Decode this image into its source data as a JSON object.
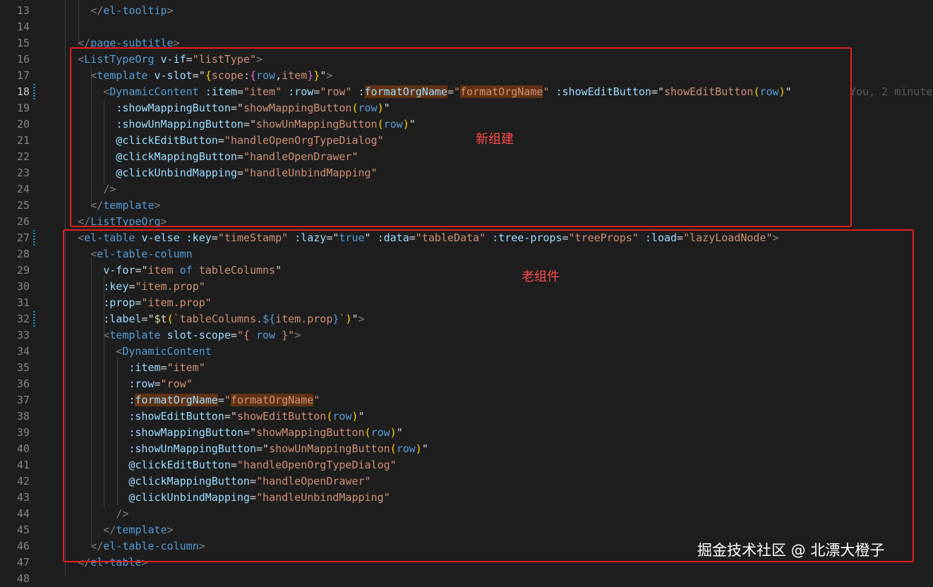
{
  "editor": {
    "lines": [
      {
        "n": "13",
        "indent": 6,
        "tokens": [
          [
            "</",
            "p"
          ],
          [
            "el-tooltip",
            "t"
          ],
          [
            ">",
            "p"
          ]
        ]
      },
      {
        "n": "14",
        "indent": 0,
        "tokens": []
      },
      {
        "n": "15",
        "indent": 4,
        "tokens": [
          [
            "</",
            "p"
          ],
          [
            "page-subtitle",
            "t"
          ],
          [
            ">",
            "p"
          ]
        ]
      },
      {
        "n": "16",
        "indent": 4,
        "tokens": [
          [
            "<",
            "p"
          ],
          [
            "ListTypeOrg",
            "t"
          ],
          [
            " ",
            "x"
          ],
          [
            "v-if",
            "a"
          ],
          [
            "=",
            "x"
          ],
          [
            "\"listType\"",
            "v"
          ],
          [
            ">",
            "p"
          ]
        ]
      },
      {
        "n": "17",
        "indent": 6,
        "tokens": [
          [
            "<",
            "p"
          ],
          [
            "template",
            "t"
          ],
          [
            " ",
            "x"
          ],
          [
            "v-slot",
            "a"
          ],
          [
            "=",
            "x"
          ],
          [
            "\"",
            "x"
          ],
          [
            "{",
            "y"
          ],
          [
            "scope",
            "v"
          ],
          [
            ":",
            "x"
          ],
          [
            "{",
            "m"
          ],
          [
            "row",
            "b"
          ],
          [
            ",",
            "x"
          ],
          [
            "item",
            "v"
          ],
          [
            "}",
            "m"
          ],
          [
            "}",
            "y"
          ],
          [
            "\"",
            "x"
          ],
          [
            ">",
            "p"
          ]
        ]
      },
      {
        "n": "18",
        "indent": 8,
        "tokens": [
          [
            "<",
            "p"
          ],
          [
            "DynamicContent",
            "t"
          ],
          [
            " ",
            "x"
          ],
          [
            ":item",
            "a"
          ],
          [
            "=",
            "x"
          ],
          [
            "\"item\"",
            "v"
          ],
          [
            " ",
            "x"
          ],
          [
            ":row",
            "a"
          ],
          [
            "=",
            "x"
          ],
          [
            "\"row\"",
            "v"
          ],
          [
            " ",
            "x"
          ],
          [
            ":",
            "a"
          ],
          [
            "formatOrgName",
            "ah"
          ],
          [
            "=",
            "x"
          ],
          [
            "\"",
            "v"
          ],
          [
            "formatOrgName",
            "vh"
          ],
          [
            "\"",
            "v"
          ],
          [
            " ",
            "x"
          ],
          [
            ":showEditButton",
            "a"
          ],
          [
            "=",
            "x"
          ],
          [
            "\"",
            "x"
          ],
          [
            "showEditButton",
            "v"
          ],
          [
            "(",
            "y"
          ],
          [
            "row",
            "b"
          ],
          [
            ")",
            "y"
          ],
          [
            "\"",
            "x"
          ]
        ]
      },
      {
        "n": "19",
        "indent": 10,
        "tokens": [
          [
            ":showMappingButton",
            "a"
          ],
          [
            "=",
            "x"
          ],
          [
            "\"",
            "x"
          ],
          [
            "showMappingButton",
            "v"
          ],
          [
            "(",
            "y"
          ],
          [
            "row",
            "b"
          ],
          [
            ")",
            "y"
          ],
          [
            "\"",
            "x"
          ]
        ]
      },
      {
        "n": "20",
        "indent": 10,
        "tokens": [
          [
            ":showUnMappingButton",
            "a"
          ],
          [
            "=",
            "x"
          ],
          [
            "\"",
            "x"
          ],
          [
            "showUnMappingButton",
            "v"
          ],
          [
            "(",
            "y"
          ],
          [
            "row",
            "b"
          ],
          [
            ")",
            "y"
          ],
          [
            "\"",
            "x"
          ]
        ]
      },
      {
        "n": "21",
        "indent": 10,
        "tokens": [
          [
            "@clickEditButton",
            "a"
          ],
          [
            "=",
            "x"
          ],
          [
            "\"handleOpenOrgTypeDialog\"",
            "v"
          ]
        ]
      },
      {
        "n": "22",
        "indent": 10,
        "tokens": [
          [
            "@clickMappingButton",
            "a"
          ],
          [
            "=",
            "x"
          ],
          [
            "\"handleOpenDrawer\"",
            "v"
          ]
        ]
      },
      {
        "n": "23",
        "indent": 10,
        "tokens": [
          [
            "@clickUnbindMapping",
            "a"
          ],
          [
            "=",
            "x"
          ],
          [
            "\"handleUnbindMapping\"",
            "v"
          ]
        ]
      },
      {
        "n": "24",
        "indent": 8,
        "tokens": [
          [
            "/>",
            "p"
          ]
        ]
      },
      {
        "n": "25",
        "indent": 6,
        "tokens": [
          [
            "</",
            "p"
          ],
          [
            "template",
            "t"
          ],
          [
            ">",
            "p"
          ]
        ]
      },
      {
        "n": "26",
        "indent": 4,
        "tokens": [
          [
            "</",
            "p"
          ],
          [
            "ListTypeOrg",
            "t"
          ],
          [
            ">",
            "p"
          ]
        ]
      },
      {
        "n": "27",
        "indent": 4,
        "tokens": [
          [
            "<",
            "p"
          ],
          [
            "el-table",
            "t"
          ],
          [
            " ",
            "x"
          ],
          [
            "v-else",
            "a"
          ],
          [
            " ",
            "x"
          ],
          [
            ":key",
            "a"
          ],
          [
            "=",
            "x"
          ],
          [
            "\"timeStamp\"",
            "v"
          ],
          [
            " ",
            "x"
          ],
          [
            ":lazy",
            "a"
          ],
          [
            "=",
            "x"
          ],
          [
            "\"",
            "x"
          ],
          [
            "true",
            "k"
          ],
          [
            "\"",
            "x"
          ],
          [
            " ",
            "x"
          ],
          [
            ":data",
            "a"
          ],
          [
            "=",
            "x"
          ],
          [
            "\"tableData\"",
            "v"
          ],
          [
            " ",
            "x"
          ],
          [
            ":tree-props",
            "a"
          ],
          [
            "=",
            "x"
          ],
          [
            "\"treeProps\"",
            "v"
          ],
          [
            " ",
            "x"
          ],
          [
            ":load",
            "a"
          ],
          [
            "=",
            "x"
          ],
          [
            "\"lazyLoadNode\"",
            "v"
          ],
          [
            ">",
            "p"
          ]
        ]
      },
      {
        "n": "28",
        "indent": 6,
        "tokens": [
          [
            "<",
            "p"
          ],
          [
            "el-table-column",
            "t"
          ]
        ]
      },
      {
        "n": "29",
        "indent": 8,
        "tokens": [
          [
            "v-for",
            "a"
          ],
          [
            "=",
            "x"
          ],
          [
            "\"",
            "x"
          ],
          [
            "item",
            "v"
          ],
          [
            " ",
            "x"
          ],
          [
            "of",
            "k"
          ],
          [
            " ",
            "x"
          ],
          [
            "tableColumns",
            "v"
          ],
          [
            "\"",
            "x"
          ]
        ]
      },
      {
        "n": "30",
        "indent": 8,
        "tokens": [
          [
            ":key",
            "a"
          ],
          [
            "=",
            "x"
          ],
          [
            "\"item.prop\"",
            "v"
          ]
        ]
      },
      {
        "n": "31",
        "indent": 8,
        "tokens": [
          [
            ":prop",
            "a"
          ],
          [
            "=",
            "x"
          ],
          [
            "\"item.prop\"",
            "v"
          ]
        ]
      },
      {
        "n": "32",
        "indent": 8,
        "tokens": [
          [
            ":label",
            "a"
          ],
          [
            "=",
            "x"
          ],
          [
            "\"",
            "x"
          ],
          [
            "$t",
            "f"
          ],
          [
            "(",
            "y"
          ],
          [
            "`tableColumns.",
            "s"
          ],
          [
            "${",
            "k"
          ],
          [
            "item.prop",
            "v"
          ],
          [
            "}",
            "k"
          ],
          [
            "`",
            "s"
          ],
          [
            ")",
            "y"
          ],
          [
            "\"",
            "x"
          ],
          [
            ">",
            "p"
          ]
        ]
      },
      {
        "n": "33",
        "indent": 8,
        "tokens": [
          [
            "<",
            "p"
          ],
          [
            "template",
            "t"
          ],
          [
            " ",
            "x"
          ],
          [
            "slot-scope",
            "a"
          ],
          [
            "=",
            "x"
          ],
          [
            "\"{ ",
            "v"
          ],
          [
            "row",
            "b"
          ],
          [
            " }\"",
            "v"
          ],
          [
            ">",
            "p"
          ]
        ]
      },
      {
        "n": "34",
        "indent": 10,
        "tokens": [
          [
            "<",
            "p"
          ],
          [
            "DynamicContent",
            "t"
          ]
        ]
      },
      {
        "n": "35",
        "indent": 12,
        "tokens": [
          [
            ":item",
            "a"
          ],
          [
            "=",
            "x"
          ],
          [
            "\"item\"",
            "v"
          ]
        ]
      },
      {
        "n": "36",
        "indent": 12,
        "tokens": [
          [
            ":row",
            "a"
          ],
          [
            "=",
            "x"
          ],
          [
            "\"row\"",
            "v"
          ]
        ]
      },
      {
        "n": "37",
        "indent": 12,
        "tokens": [
          [
            ":",
            "a"
          ],
          [
            "formatOrgName",
            "ah"
          ],
          [
            "=",
            "x"
          ],
          [
            "\"",
            "v"
          ],
          [
            "formatOrgName",
            "vh"
          ],
          [
            "\"",
            "v"
          ]
        ]
      },
      {
        "n": "38",
        "indent": 12,
        "tokens": [
          [
            ":showEditButton",
            "a"
          ],
          [
            "=",
            "x"
          ],
          [
            "\"",
            "x"
          ],
          [
            "showEditButton",
            "v"
          ],
          [
            "(",
            "y"
          ],
          [
            "row",
            "b"
          ],
          [
            ")",
            "y"
          ],
          [
            "\"",
            "x"
          ]
        ]
      },
      {
        "n": "39",
        "indent": 12,
        "tokens": [
          [
            ":showMappingButton",
            "a"
          ],
          [
            "=",
            "x"
          ],
          [
            "\"",
            "x"
          ],
          [
            "showMappingButton",
            "v"
          ],
          [
            "(",
            "y"
          ],
          [
            "row",
            "b"
          ],
          [
            ")",
            "y"
          ],
          [
            "\"",
            "x"
          ]
        ]
      },
      {
        "n": "40",
        "indent": 12,
        "tokens": [
          [
            ":showUnMappingButton",
            "a"
          ],
          [
            "=",
            "x"
          ],
          [
            "\"",
            "x"
          ],
          [
            "showUnMappingButton",
            "v"
          ],
          [
            "(",
            "y"
          ],
          [
            "row",
            "b"
          ],
          [
            ")",
            "y"
          ],
          [
            "\"",
            "x"
          ]
        ]
      },
      {
        "n": "41",
        "indent": 12,
        "tokens": [
          [
            "@clickEditButton",
            "a"
          ],
          [
            "=",
            "x"
          ],
          [
            "\"handleOpenOrgTypeDialog\"",
            "v"
          ]
        ]
      },
      {
        "n": "42",
        "indent": 12,
        "tokens": [
          [
            "@clickMappingButton",
            "a"
          ],
          [
            "=",
            "x"
          ],
          [
            "\"handleOpenDrawer\"",
            "v"
          ]
        ]
      },
      {
        "n": "43",
        "indent": 12,
        "tokens": [
          [
            "@clickUnbindMapping",
            "a"
          ],
          [
            "=",
            "x"
          ],
          [
            "\"handleUnbindMapping\"",
            "v"
          ]
        ]
      },
      {
        "n": "44",
        "indent": 10,
        "tokens": [
          [
            "/>",
            "p"
          ]
        ]
      },
      {
        "n": "45",
        "indent": 8,
        "tokens": [
          [
            "</",
            "p"
          ],
          [
            "template",
            "t"
          ],
          [
            ">",
            "p"
          ]
        ]
      },
      {
        "n": "46",
        "indent": 6,
        "tokens": [
          [
            "</",
            "p"
          ],
          [
            "el-table-column",
            "t"
          ],
          [
            ">",
            "p"
          ]
        ]
      },
      {
        "n": "47",
        "indent": 4,
        "tokens": [
          [
            "</",
            "p"
          ],
          [
            "el-table",
            "t"
          ],
          [
            ">",
            "p"
          ]
        ]
      },
      {
        "n": "48",
        "indent": 0,
        "tokens": []
      }
    ],
    "active_line": "18",
    "modified_lines": [
      "18",
      "27",
      "32"
    ],
    "blame_annotation": "You, 2 minute"
  },
  "annotations": {
    "new_component": "新组建",
    "old_component": "老组件"
  },
  "watermark": "掘金技术社区 @ 北漂大橙子",
  "colors": {
    "editor_background": "#1e1e1e",
    "line_number": "#858585",
    "tag_name": "#569cd6",
    "tag_punctuation": "#808080",
    "attribute": "#9cdcfe",
    "string": "#ce9178",
    "keyword": "#569cd6",
    "bracket_yellow": "#ffd700",
    "bracket_magenta": "#da70d6",
    "function": "#dcdcaa",
    "highlight": "#613214",
    "annotation_box": "#e52020",
    "annotation_text": "#ff4a4a"
  }
}
